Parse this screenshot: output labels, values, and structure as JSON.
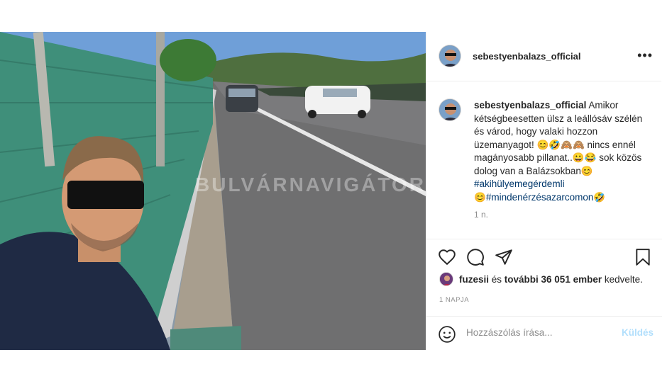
{
  "post": {
    "watermark": "BULVÁRNAVIGÁTOR",
    "header": {
      "username": "sebestyenbalazs_official",
      "more_label": "•••"
    },
    "caption": {
      "username": "sebestyenbalazs_official",
      "text": "Amikor kétségbeesetten ülsz a leállósáv szélén és várod, hogy valaki hozzon üzemanyagot! 😊🤣🙈🙈 nincs ennél magányosabb pillanat..😀😂 sok közös dolog van a Balázsokban😊",
      "hashtag_1": "#akihülyemegérdemli",
      "emoji_prefix": "😊",
      "hashtag_2": "#mindenérzésazarcomon",
      "emoji_suffix": "🤣",
      "posted_time": "1 n."
    },
    "likes": {
      "liker": "fuzesii",
      "middle": " és ",
      "others": "további 36 051 ember",
      "suffix": " kedvelte."
    },
    "date_label": "1 NAPJA",
    "comment": {
      "placeholder": "Hozzászólás írása...",
      "send_label": "Küldés"
    },
    "icons": {
      "like": "heart-icon",
      "comment": "comment-icon",
      "share": "paper-plane-icon",
      "save": "bookmark-icon",
      "emoji": "smiley-icon",
      "more": "more-options-icon"
    }
  }
}
